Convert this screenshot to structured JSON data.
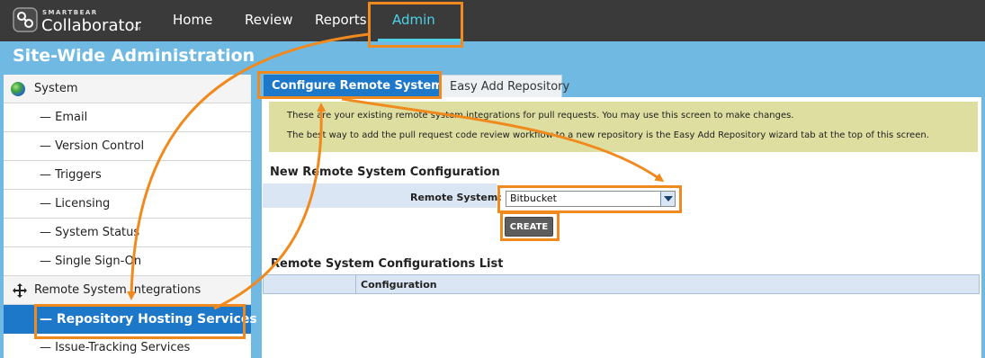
{
  "app": {
    "brand_small": "SMARTBEAR",
    "brand_name": "Collaborator",
    "brand_tm": "TM"
  },
  "nav": {
    "items": [
      "Home",
      "Review",
      "Reports",
      "Admin"
    ],
    "active": "Admin",
    "active_color": "#4cd1e6"
  },
  "page": {
    "title": "Site-Wide Administration"
  },
  "sidebar": {
    "items": [
      {
        "label": "System",
        "icon": "globe-icon"
      },
      {
        "label": "— Email"
      },
      {
        "label": "— Version Control"
      },
      {
        "label": "— Triggers"
      },
      {
        "label": "— Licensing"
      },
      {
        "label": "— System Status"
      },
      {
        "label": "— Single Sign-On"
      },
      {
        "label": "Remote System Integrations",
        "icon": "move-icon"
      },
      {
        "label": "— Repository Hosting Services",
        "selected": true
      },
      {
        "label": "— Issue-Tracking Services"
      }
    ]
  },
  "tabs": [
    {
      "label": "Configure Remote Systems",
      "active": true
    },
    {
      "label": "Easy Add Repository",
      "active": false
    }
  ],
  "info": {
    "line1": "These are your existing remote system integrations for pull requests. You may use this screen to make changes.",
    "line2": "The best way to add the pull request code review workflow to a new repository is the Easy Add Repository wizard tab at the top of this screen."
  },
  "form": {
    "title": "New Remote System Configuration",
    "remote_system_label": "Remote System:",
    "remote_system_value": "Bitbucket",
    "create_label": "CREATE"
  },
  "list": {
    "title": "Remote System Configurations List",
    "columns": [
      "",
      "Configuration"
    ]
  },
  "colors": {
    "highlight": "#f18a1e",
    "accent": "#1e78c9",
    "background": "#6fb9e2",
    "topbar": "#3a3a3a"
  }
}
